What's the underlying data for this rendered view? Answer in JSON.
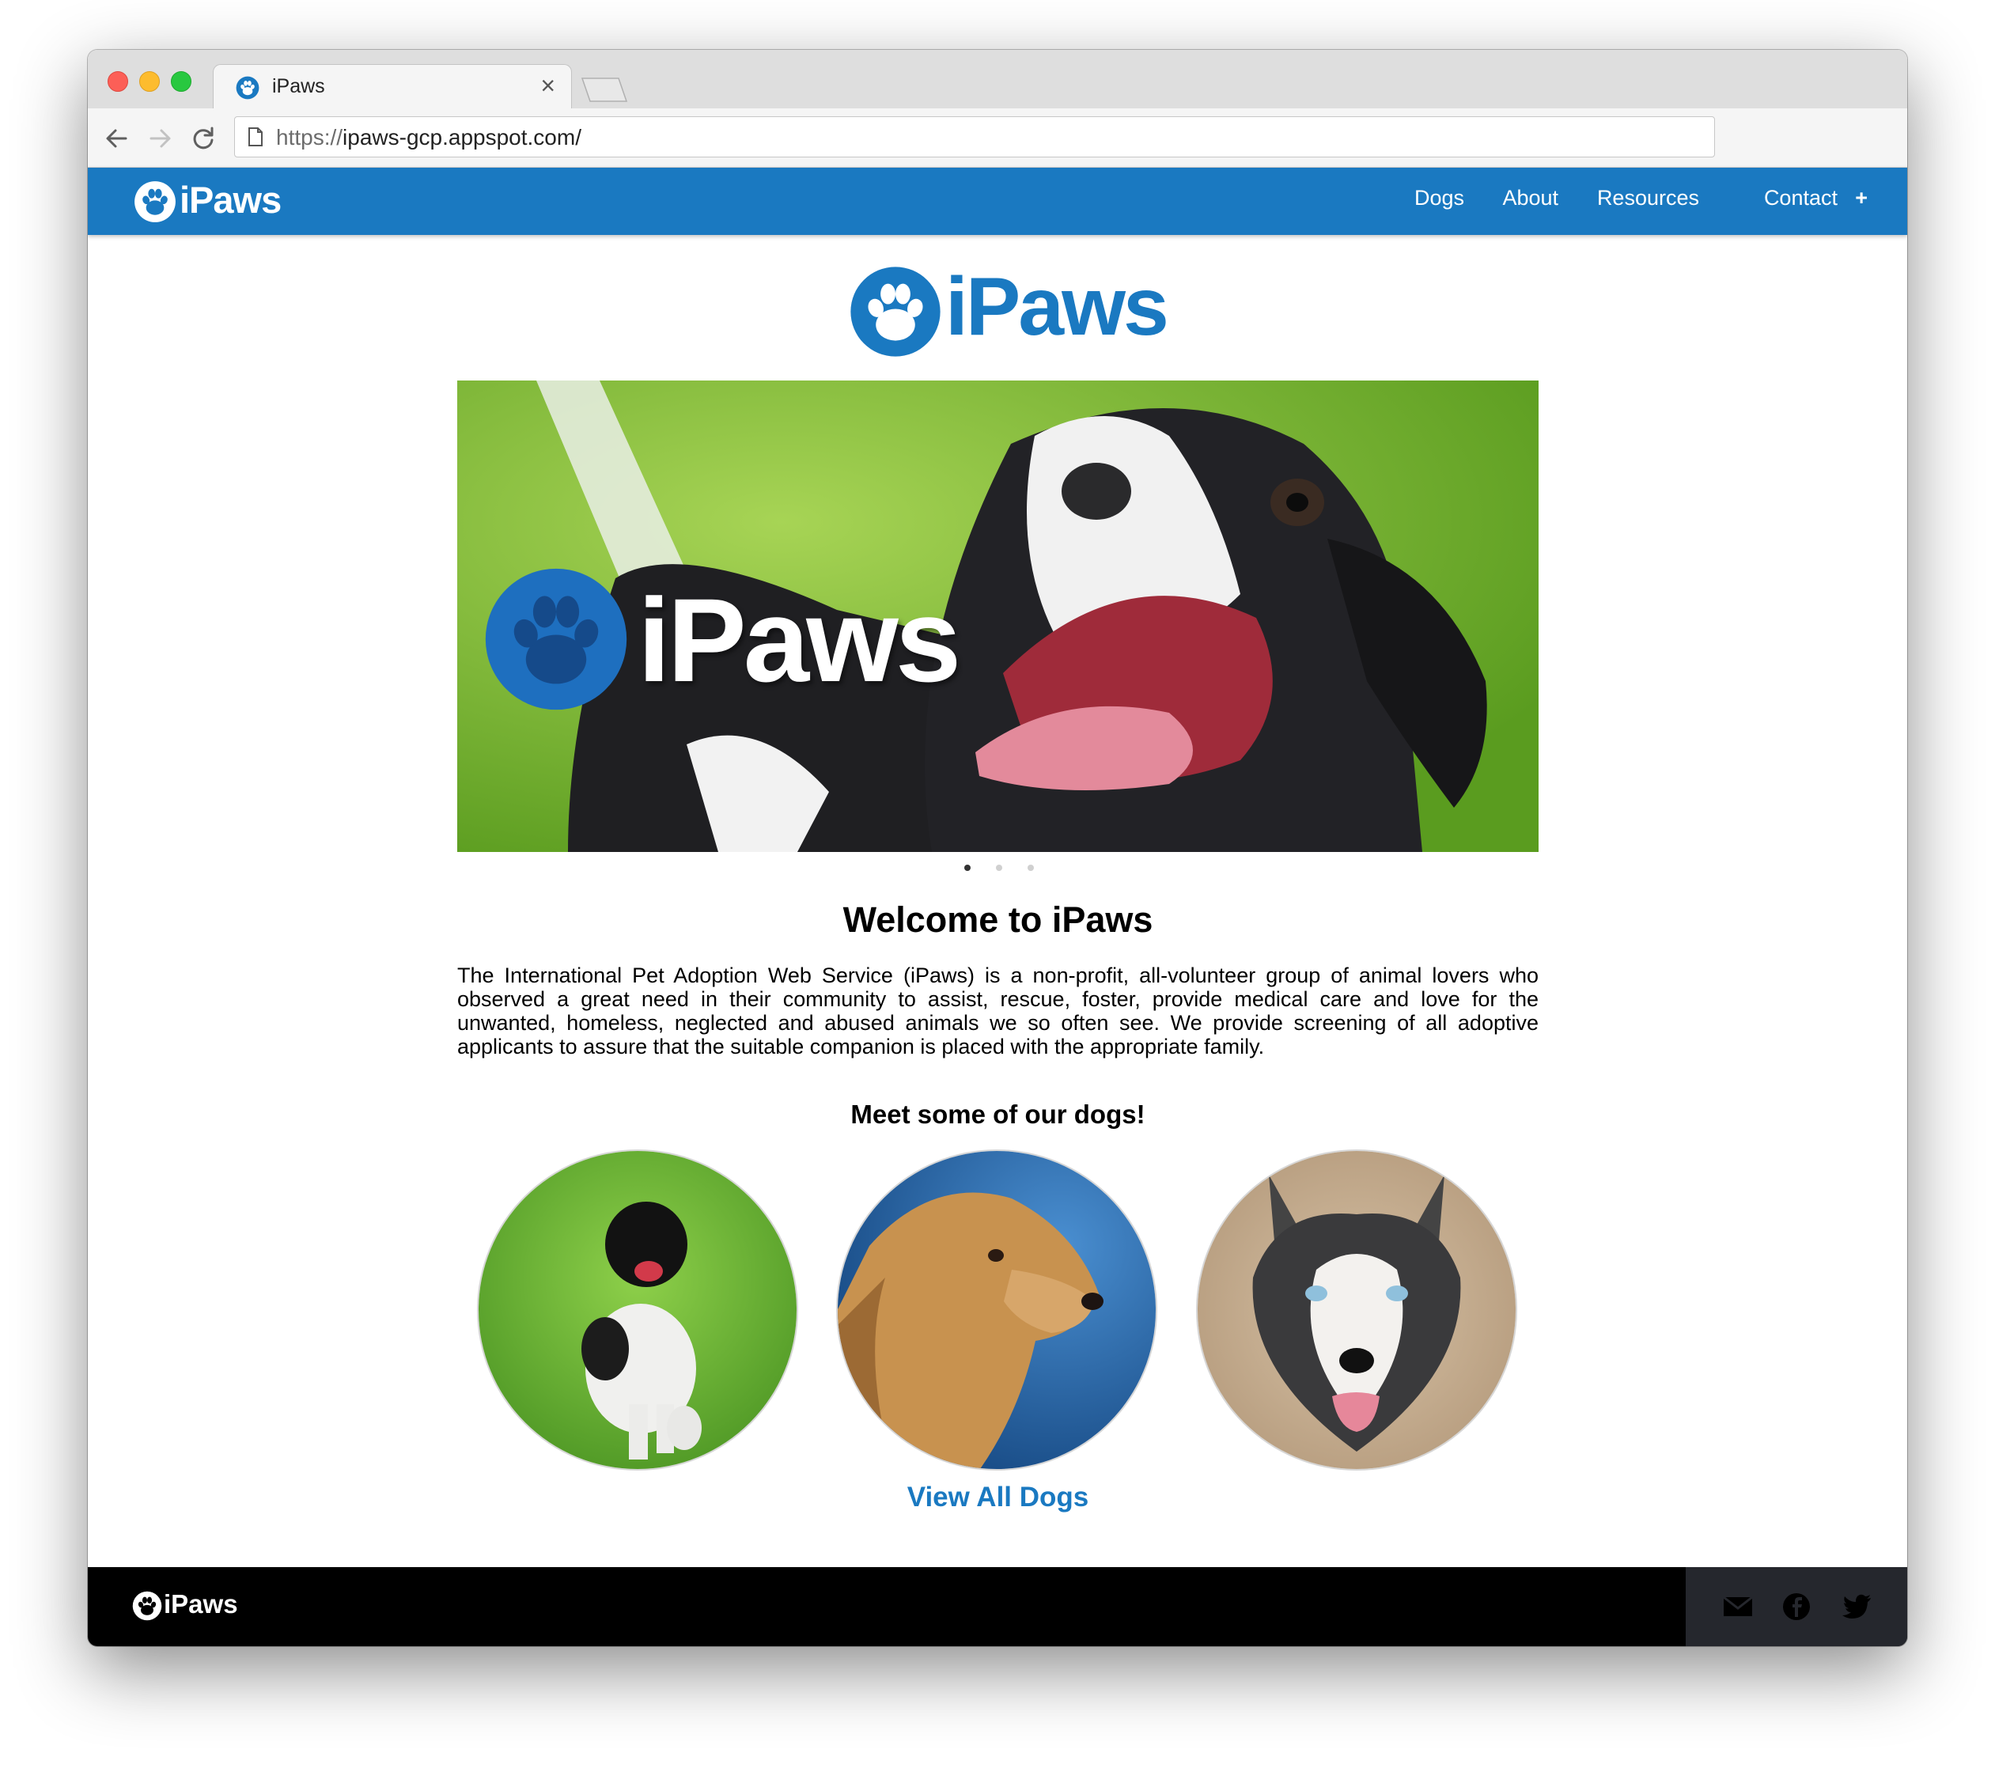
{
  "browser": {
    "tab_title": "iPaws",
    "tab_close": "×",
    "url_scheme": "https://",
    "url_host": "ipaws-gcp.appspot.com/"
  },
  "site": {
    "brand": "iPaws",
    "nav": [
      "Dogs",
      "About",
      "Resources",
      "Contact",
      "+"
    ],
    "brand_color": "#1a79c1"
  },
  "main": {
    "logo_text": "iPaws",
    "hero": {
      "logo_text": "iPaws",
      "slide_count": 3,
      "active_slide": 1
    },
    "welcome_title": "Welcome to iPaws",
    "intro": "The International Pet Adoption Web Service (iPaws) is a non-profit, all-volunteer group of animal lovers who observed a great need in their community to assist, rescue, foster, provide medical care and love for the unwanted, homeless, neglected and abused animals we so often see.  We provide screening of all adoptive applicants to assure that the suitable companion is placed with the appropriate family.",
    "meet_title": "Meet some of our dogs!",
    "view_all": "View All Dogs"
  },
  "footer": {
    "brand": "iPaws",
    "icons": [
      "mail-icon",
      "facebook-icon",
      "twitter-icon"
    ]
  }
}
